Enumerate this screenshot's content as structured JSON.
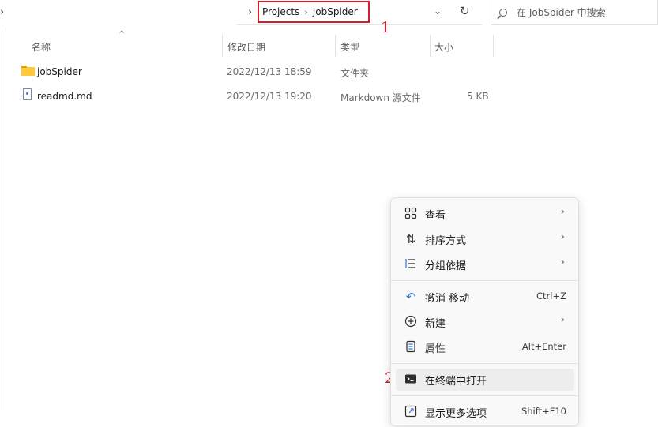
{
  "address_bar": {
    "breadcrumbs": [
      "Projects",
      "JobSpider"
    ],
    "search_placeholder": "在 JobSpider 中搜索"
  },
  "annotations": [
    "1",
    "2"
  ],
  "file_list": {
    "columns": [
      "名称",
      "修改日期",
      "类型",
      "大小"
    ],
    "rows": [
      {
        "icon": "folder-icon",
        "name": "jobSpider",
        "modified": "2022/12/13 18:59",
        "type": "文件夹",
        "size": ""
      },
      {
        "icon": "markdown-file-icon",
        "name": "readmd.md",
        "modified": "2022/12/13 19:20",
        "type": "Markdown 源文件",
        "size": "5 KB"
      }
    ]
  },
  "context_menu": {
    "items": [
      {
        "icon": "grid-view-icon",
        "label": "查看",
        "shortcut": "",
        "submenu": true
      },
      {
        "icon": "sort-icon",
        "label": "排序方式",
        "shortcut": "",
        "submenu": true
      },
      {
        "icon": "group-by-icon",
        "label": "分组依据",
        "shortcut": "",
        "submenu": true
      },
      {
        "icon": "undo-icon",
        "label": "撤消 移动",
        "shortcut": "Ctrl+Z",
        "submenu": false
      },
      {
        "icon": "new-icon",
        "label": "新建",
        "shortcut": "",
        "submenu": true
      },
      {
        "icon": "properties-icon",
        "label": "属性",
        "shortcut": "Alt+Enter",
        "submenu": false
      },
      {
        "icon": "terminal-icon",
        "label": "在终端中打开",
        "shortcut": "",
        "submenu": false
      },
      {
        "icon": "more-options-icon",
        "label": "显示更多选项",
        "shortcut": "Shift+F10",
        "submenu": false
      }
    ]
  },
  "colors": {
    "annotation": "#d71d2c",
    "folder": "#ffc83d",
    "menu_bg": "#f9f9f9"
  }
}
